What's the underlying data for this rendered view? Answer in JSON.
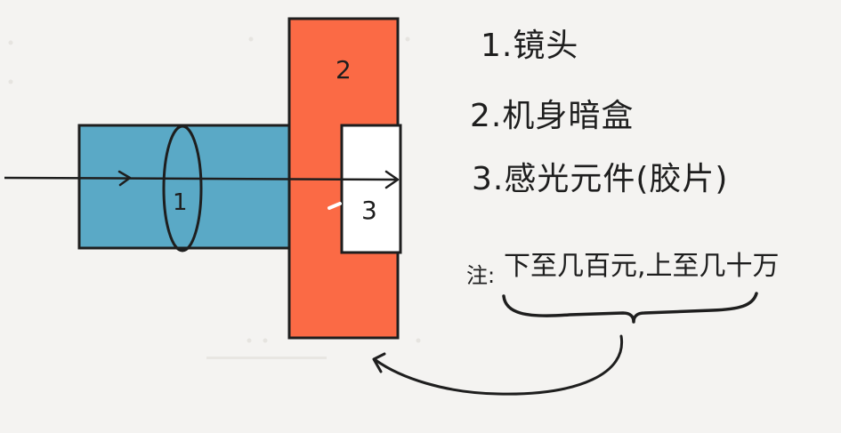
{
  "diagram": {
    "parts": [
      {
        "id": "1",
        "label": "1"
      },
      {
        "id": "2",
        "label": "2"
      },
      {
        "id": "3",
        "label": "3"
      }
    ],
    "legend": [
      "1.镜头",
      "2.机身暗盒",
      "3.感光元件(胶片)"
    ],
    "note": {
      "label": "注:",
      "text": "下至几百元,上至几十万"
    },
    "colors": {
      "background": "#f4f3f1",
      "lens_block": "#5aa9c6",
      "body_block": "#fb6a45",
      "sensor_block": "#ffffff",
      "ink": "#1e1e1e"
    }
  }
}
